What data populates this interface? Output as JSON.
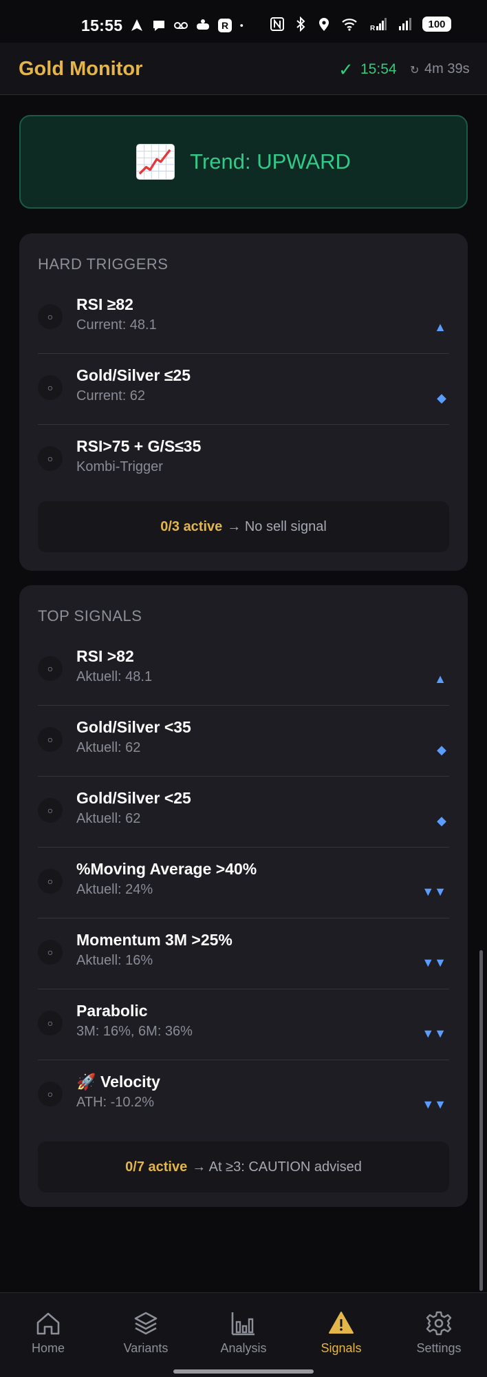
{
  "status_bar": {
    "time": "15:55",
    "battery": "100",
    "icons_left": [
      "navigation-icon",
      "chat-icon",
      "voicemail-icon",
      "game-icon",
      "r-app-icon",
      "dot-icon"
    ],
    "icons_right": [
      "nfc-icon",
      "bluetooth-icon",
      "location-icon",
      "wifi-icon",
      "signal-icon",
      "signal-icon"
    ]
  },
  "header": {
    "title": "Gold Monitor",
    "sync_time": "15:54",
    "refresh_countdown": "4m 39s"
  },
  "trend": {
    "label": "Trend: UPWARD"
  },
  "hard_triggers": {
    "heading": "HARD TRIGGERS",
    "items": [
      {
        "title": "RSI ≥82",
        "subtitle": "Current: 48.1",
        "indicator": "▲"
      },
      {
        "title": "Gold/Silver ≤25",
        "subtitle": "Current: 62",
        "indicator": "◆"
      },
      {
        "title": "RSI>75 + G/S≤35",
        "subtitle": "Kombi-Trigger",
        "indicator": ""
      }
    ],
    "summary_strong": "0/3 active",
    "summary_rest": "→ No sell signal"
  },
  "top_signals": {
    "heading": "TOP SIGNALS",
    "items": [
      {
        "title": "RSI >82",
        "subtitle": "Aktuell: 48.1",
        "indicator": "▲"
      },
      {
        "title": "Gold/Silver <35",
        "subtitle": "Aktuell: 62",
        "indicator": "◆"
      },
      {
        "title": "Gold/Silver <25",
        "subtitle": "Aktuell: 62",
        "indicator": "◆"
      },
      {
        "title": "%Moving Average >40%",
        "subtitle": "Aktuell: 24%",
        "indicator": "▼▼"
      },
      {
        "title": "Momentum 3M >25%",
        "subtitle": "Aktuell: 16%",
        "indicator": "▼▼"
      },
      {
        "title": "Parabolic",
        "subtitle": "3M: 16%, 6M: 36%",
        "indicator": "▼▼"
      },
      {
        "title": "🚀 Velocity",
        "subtitle": "ATH: -10.2%",
        "indicator": "▼▼"
      }
    ],
    "summary_strong": "0/7 active",
    "summary_rest": "→ At ≥3: CAUTION advised"
  },
  "row_dot": "○",
  "nav": {
    "items": [
      {
        "label": "Home",
        "icon": "home-icon",
        "active": false
      },
      {
        "label": "Variants",
        "icon": "layers-icon",
        "active": false
      },
      {
        "label": "Analysis",
        "icon": "bar-chart-icon",
        "active": false
      },
      {
        "label": "Signals",
        "icon": "warning-icon",
        "active": true
      },
      {
        "label": "Settings",
        "icon": "gear-icon",
        "active": false
      }
    ]
  },
  "colors": {
    "accent_gold": "#e4b548",
    "trend_green": "#33c98a",
    "indicator_blue": "#5b9dff",
    "card_bg": "#1d1d23"
  }
}
